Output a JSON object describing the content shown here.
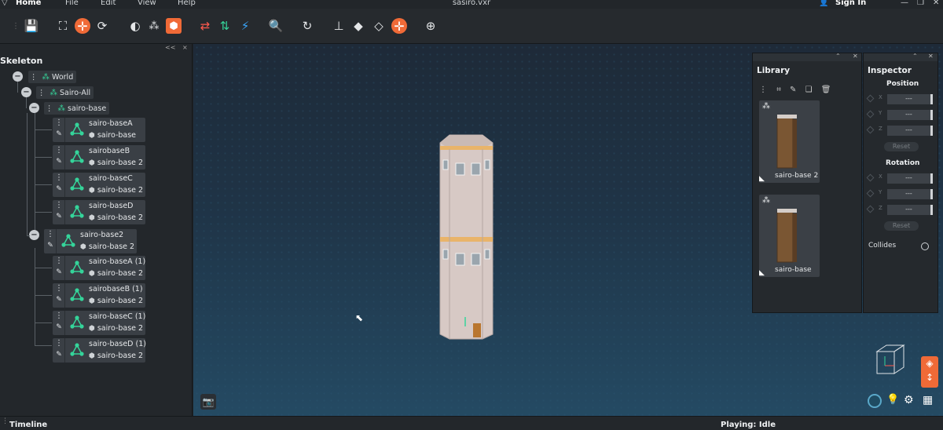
{
  "app": {
    "home_label": "Home",
    "menu": [
      "File",
      "Edit",
      "View",
      "Help"
    ],
    "file_title": "sasiro.vxr",
    "sign_in": "Sign In",
    "window_controls": [
      "minimize-icon",
      "restore-icon",
      "close-icon"
    ]
  },
  "toolbar": {
    "buttons": [
      "save-icon",
      "fit-view-icon",
      "add-icon",
      "refresh-icon",
      "globe-icon",
      "nodes-icon",
      "cube-icon",
      "swap-icon",
      "split-icon",
      "link-icon",
      "search-globe-icon",
      "rotate-icon",
      "hierarchy-icon",
      "box-filled-icon",
      "box-outline-icon",
      "add-icon",
      "target-icon"
    ]
  },
  "skeleton": {
    "title": "Skeleton",
    "panel_controls": [
      "<<",
      "×"
    ],
    "groups": [
      {
        "label": "World"
      },
      {
        "label": "Sairo-All"
      },
      {
        "label": "sairo-base"
      }
    ],
    "items": [
      {
        "name": "sairo-baseA",
        "sub": "sairo-base"
      },
      {
        "name": "sairobaseB",
        "sub": "sairo-base 2"
      },
      {
        "name": "sairo-baseC",
        "sub": "sairo-base 2"
      },
      {
        "name": "sairo-baseD",
        "sub": "sairo-base 2"
      },
      {
        "name": "sairo-base2",
        "sub": "sairo-base 2"
      },
      {
        "name": "sairo-baseA (1)",
        "sub": "sairo-base 2"
      },
      {
        "name": "sairobaseB (1)",
        "sub": "sairo-base 2"
      },
      {
        "name": "sairo-baseC (1)",
        "sub": "sairo-base 2"
      },
      {
        "name": "sairo-baseD (1)",
        "sub": "sairo-base 2"
      }
    ]
  },
  "library": {
    "title": "Library",
    "tools": [
      "more-icon",
      "crop-icon",
      "pencil-icon",
      "copy-icon",
      "trash-icon"
    ],
    "items": [
      {
        "label": "sairo-base 2"
      },
      {
        "label": "sairo-base"
      }
    ]
  },
  "inspector": {
    "title": "Inspector",
    "position_label": "Position",
    "rotation_label": "Rotation",
    "axes": [
      "X",
      "Y",
      "Z"
    ],
    "field_value": "---",
    "reset_label": "Reset",
    "collides_label": "Collides"
  },
  "bottom": {
    "timeline_label": "Timeline",
    "status": "Playing: Idle"
  },
  "colors": {
    "accent": "#f06a37",
    "green": "#35d49a",
    "panel": "#23272b"
  }
}
